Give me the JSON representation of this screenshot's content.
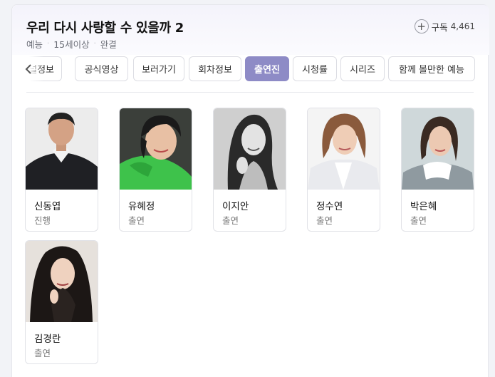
{
  "show": {
    "title": "우리 다시 사랑할 수 있을까 2",
    "genre": "예능",
    "rating": "15세이상",
    "status": "완결",
    "meta_separator": "·"
  },
  "subscribe": {
    "plus_glyph": "+",
    "label": "구독",
    "count": "4,461"
  },
  "tabs": [
    {
      "label": "채널정보",
      "active": false
    },
    {
      "label": "공식영상",
      "active": false
    },
    {
      "label": "보러가기",
      "active": false
    },
    {
      "label": "회차정보",
      "active": false
    },
    {
      "label": "출연진",
      "active": true
    },
    {
      "label": "시청률",
      "active": false
    },
    {
      "label": "시리즈",
      "active": false
    },
    {
      "label": "함께 볼만한 예능",
      "active": false
    }
  ],
  "tab_prev_icon": "chevron-left-icon",
  "cast": [
    {
      "name": "신동엽",
      "role": "진행"
    },
    {
      "name": "유혜정",
      "role": "출연"
    },
    {
      "name": "이지안",
      "role": "출연"
    },
    {
      "name": "정수연",
      "role": "출연"
    },
    {
      "name": "박은혜",
      "role": "출연"
    },
    {
      "name": "김경란",
      "role": "출연"
    }
  ],
  "colors": {
    "accent": "#8e8bc6",
    "header_bg": "#f4f3fb"
  }
}
